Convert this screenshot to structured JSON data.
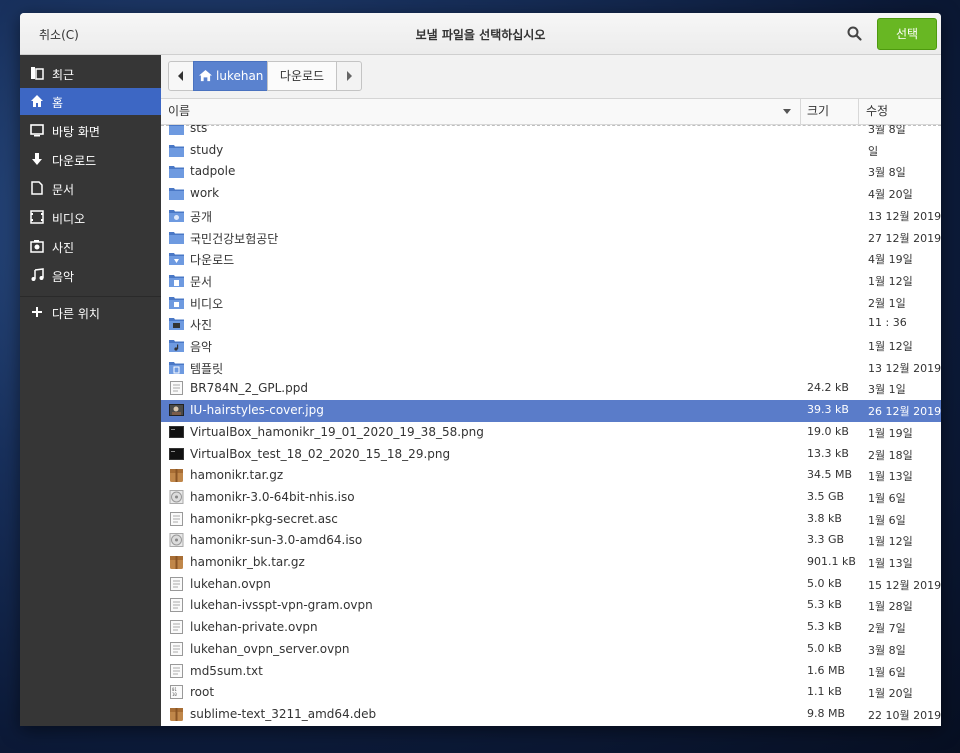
{
  "titlebar": {
    "cancel_label": "취소(C)",
    "title": "보낼 파일을 선택하십시오",
    "select_label": "선택"
  },
  "sidebar": {
    "items": [
      {
        "label": "최근",
        "icon": "recent-icon"
      },
      {
        "label": "홈",
        "icon": "home-icon"
      },
      {
        "label": "바탕 화면",
        "icon": "desktop-icon"
      },
      {
        "label": "다운로드",
        "icon": "download-icon"
      },
      {
        "label": "문서",
        "icon": "document-icon"
      },
      {
        "label": "비디오",
        "icon": "video-icon"
      },
      {
        "label": "사진",
        "icon": "pictures-icon"
      },
      {
        "label": "음악",
        "icon": "music-icon"
      }
    ],
    "other_label": "다른 위치",
    "active_index": 1
  },
  "pathbar": {
    "home_label": "lukehan",
    "current_label": "다운로드"
  },
  "columns": {
    "name": "이름",
    "size": "크기",
    "modified": "수정"
  },
  "files": [
    {
      "name": "sts",
      "size": "",
      "modified": "3월 8일",
      "icon": "folder"
    },
    {
      "name": "study",
      "size": "",
      "modified": "일",
      "icon": "folder"
    },
    {
      "name": "tadpole",
      "size": "",
      "modified": "3월 8일",
      "icon": "folder"
    },
    {
      "name": "work",
      "size": "",
      "modified": "4월 20일",
      "icon": "folder"
    },
    {
      "name": "공개",
      "size": "",
      "modified": "13 12월 2019",
      "icon": "folder-public"
    },
    {
      "name": "국민건강보험공단",
      "size": "",
      "modified": "27 12월 2019",
      "icon": "folder"
    },
    {
      "name": "다운로드",
      "size": "",
      "modified": "4월 19일",
      "icon": "folder-download"
    },
    {
      "name": "문서",
      "size": "",
      "modified": "1월 12일",
      "icon": "folder-documents"
    },
    {
      "name": "비디오",
      "size": "",
      "modified": "2월 1일",
      "icon": "folder-videos"
    },
    {
      "name": "사진",
      "size": "",
      "modified": "11 : 36",
      "icon": "folder-pictures"
    },
    {
      "name": "음악",
      "size": "",
      "modified": "1월 12일",
      "icon": "folder-music"
    },
    {
      "name": "템플릿",
      "size": "",
      "modified": "13 12월 2019",
      "icon": "folder-templates"
    },
    {
      "name": "BR784N_2_GPL.ppd",
      "size": "24.2 kB",
      "modified": "3월 1일",
      "icon": "text"
    },
    {
      "name": "IU-hairstyles-cover.jpg",
      "size": "39.3 kB",
      "modified": "26 12월 2019",
      "icon": "image"
    },
    {
      "name": "VirtualBox_hamonikr_19_01_2020_19_38_58.png",
      "size": "19.0 kB",
      "modified": "1월 19일",
      "icon": "image-dark"
    },
    {
      "name": "VirtualBox_test_18_02_2020_15_18_29.png",
      "size": "13.3 kB",
      "modified": "2월 18일",
      "icon": "image-dark"
    },
    {
      "name": "hamonikr.tar.gz",
      "size": "34.5 MB",
      "modified": "1월 13일",
      "icon": "archive"
    },
    {
      "name": "hamonikr-3.0-64bit-nhis.iso",
      "size": "3.5 GB",
      "modified": "1월 6일",
      "icon": "disc"
    },
    {
      "name": "hamonikr-pkg-secret.asc",
      "size": "3.8 kB",
      "modified": "1월 6일",
      "icon": "text"
    },
    {
      "name": "hamonikr-sun-3.0-amd64.iso",
      "size": "3.3 GB",
      "modified": "1월 12일",
      "icon": "disc"
    },
    {
      "name": "hamonikr_bk.tar.gz",
      "size": "901.1 kB",
      "modified": "1월 13일",
      "icon": "archive"
    },
    {
      "name": "lukehan.ovpn",
      "size": "5.0 kB",
      "modified": "15 12월 2019",
      "icon": "text"
    },
    {
      "name": "lukehan-ivsspt-vpn-gram.ovpn",
      "size": "5.3 kB",
      "modified": "1월 28일",
      "icon": "text"
    },
    {
      "name": "lukehan-private.ovpn",
      "size": "5.3 kB",
      "modified": "2월 7일",
      "icon": "text"
    },
    {
      "name": "lukehan_ovpn_server.ovpn",
      "size": "5.0 kB",
      "modified": "3월 8일",
      "icon": "text"
    },
    {
      "name": "md5sum.txt",
      "size": "1.6 MB",
      "modified": "1월 6일",
      "icon": "text"
    },
    {
      "name": "root",
      "size": "1.1 kB",
      "modified": "1월 20일",
      "icon": "binary"
    },
    {
      "name": "sublime-text_3211_amd64.deb",
      "size": "9.8 MB",
      "modified": "22 10월 2019",
      "icon": "archive"
    }
  ],
  "selected_file_index": 13,
  "colors": {
    "accent": "#5a7cc9",
    "select_button": "#68b723",
    "sidebar_bg": "#363636",
    "sidebar_active": "#3d67c4"
  }
}
